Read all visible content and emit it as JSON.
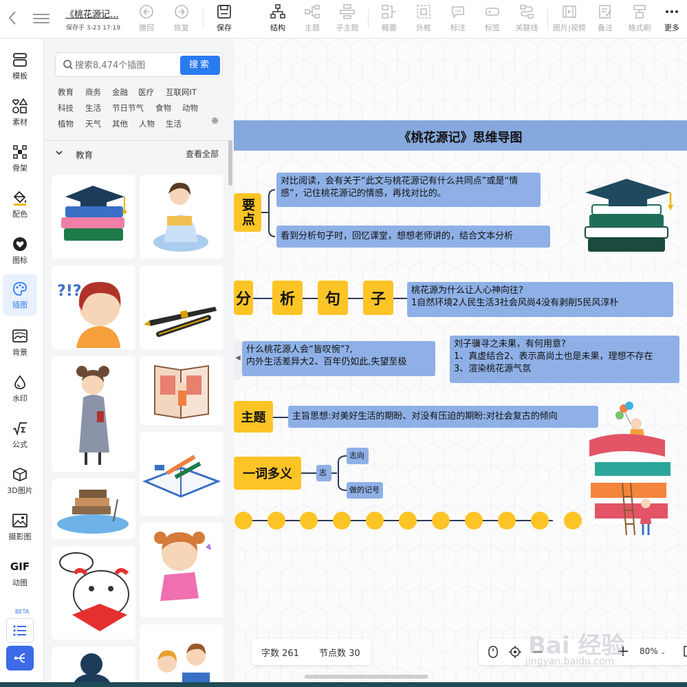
{
  "toolbar": {
    "doc_title": "《桃花源记...",
    "saved_text": "保存于 3-23 17:19",
    "buttons": {
      "undo": "撤回",
      "redo": "恢复",
      "save": "保存",
      "structure": "结构",
      "topic": "主题",
      "subtopic": "子主题",
      "summary": "概要",
      "frame": "外框",
      "note": "标注",
      "tag": "标签",
      "link": "关联线",
      "image_video": "图片|视频",
      "remark": "备注",
      "format_brush": "格式刷",
      "more": "更多"
    }
  },
  "leftrail": {
    "items": [
      "模板",
      "素材",
      "骨架",
      "配色",
      "图标",
      "插图",
      "背景",
      "水印",
      "公式",
      "3D图片",
      "摄影图",
      "动图"
    ],
    "gif_text": "GIF",
    "beta": "BETA",
    "active": "插图"
  },
  "panel": {
    "search_placeholder": "搜索8,474个插图",
    "search_button": "搜索",
    "tags": [
      "教育",
      "商务",
      "金融",
      "医疗",
      "互联网IT",
      "科技",
      "生活",
      "节日节气",
      "食物",
      "动物",
      "植物",
      "天气",
      "其他",
      "人物",
      "生活"
    ],
    "category": "教育",
    "view_all": "查看全部"
  },
  "mindmap": {
    "title": "《桃花源记》思维导图",
    "key_points": {
      "label": "要点",
      "items": [
        "对比阅读，会有关于“此文与桃花源记有什么共同点”或是“情感”，记住桃花源记的情感，再找对比的。",
        "看到分析句子时，回忆课堂，想想老师讲的，结合文本分析"
      ]
    },
    "analysis": {
      "chars": [
        "分",
        "析",
        "句",
        "子"
      ],
      "q1": "桃花源为什么让人心神向往?",
      "q1_answer": "1自然环境2人民生活3社会风尚4没有剥削5民风淳朴",
      "q2": "什么桃花源人会“皆叹惋”?,",
      "q2_answer": "内外生活差异大2、百年仍如此,失望至极",
      "q3": "刘子骥寻之未果，有何用意?",
      "q3_a1": "1、真虚结合2、表示高尚土也是未果，理想不存在",
      "q3_a2": "3、渲染桃花源气氛"
    },
    "theme": {
      "label": "主题",
      "text": "主旨思想:对美好生活的期盼、对没有压迫的期盼:对社会复古的倾向"
    },
    "polysemy": {
      "label": "一词多义",
      "word": "志",
      "meanings": [
        "志向",
        "做的记号"
      ]
    }
  },
  "status": {
    "word_count": "字数 261",
    "node_count": "节点数 30",
    "zoom": "80%"
  },
  "watermark": {
    "brand": "Bai 经验",
    "url": "jingyan.baidu.com"
  }
}
